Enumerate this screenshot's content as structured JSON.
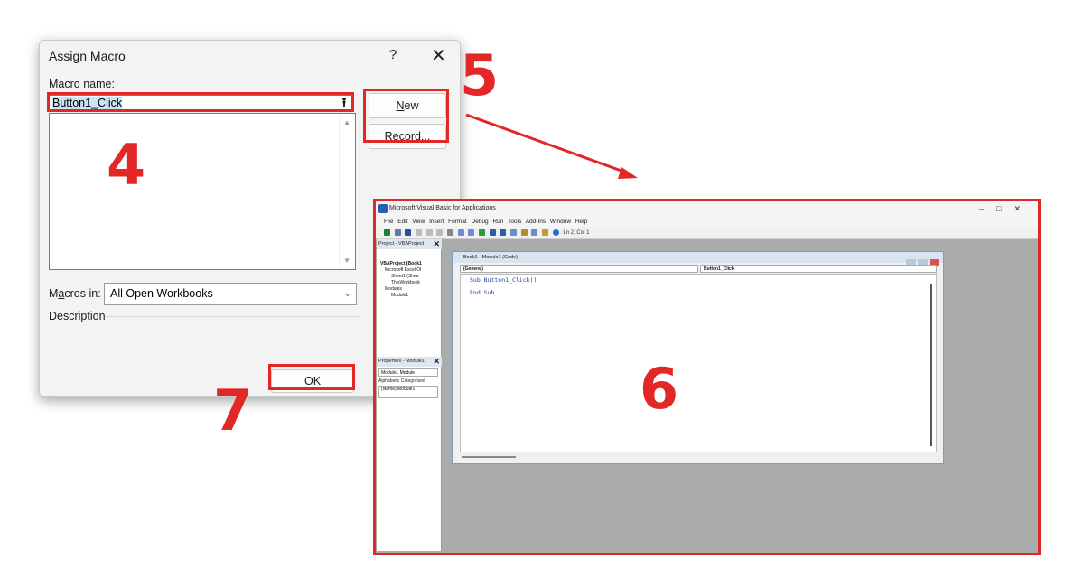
{
  "assign_macro": {
    "title": "Assign Macro",
    "help_glyph": "?",
    "close_glyph": "✕",
    "macro_name_label_prefix": "M",
    "macro_name_label_rest": "acro name:",
    "macro_name_value": "Button1_Click",
    "new_button_prefix": "N",
    "new_button_rest": "ew",
    "record_button": "Record...",
    "macros_in_label_prefix": "M",
    "macros_in_label_underlined": "a",
    "macros_in_label_rest": "cros in:",
    "macros_in_value": "All Open Workbooks",
    "description_label": "Description",
    "ok_button": "OK"
  },
  "annotations": {
    "step_4": "4",
    "step_5": "5",
    "step_6": "6",
    "step_7": "7",
    "color": "#e32626"
  },
  "vba": {
    "title": "Microsoft Visual Basic for Applications",
    "window_controls": "–□✕",
    "menu": "File  Edit  View  Insert  Format  Debug  Run  Tools  Add-Ins  Window  Help",
    "cursor_pos": "Ln 2, Col 1",
    "project_pane_title": "Project - VBAProject",
    "tree": {
      "root": "VBAProject (Book1",
      "excel_objects": "Microsoft Excel Ol",
      "sheet1": "Sheet1 (Shee",
      "thisworkbook": "ThisWorkbook",
      "modules": "Modules",
      "module1": "Module1"
    },
    "properties_pane_title": "Properties - Module1",
    "properties_object": "Module1 Module",
    "properties_tabs": "Alphabetic  Categorized",
    "properties_row": "(Name)  Module1",
    "code_window_title": "Book1 - Module1 (Code)",
    "general_dropdown": "(General)",
    "proc_dropdown": "Button1_Click",
    "code_lines": [
      "Sub Button1_Click()",
      "End Sub"
    ]
  }
}
